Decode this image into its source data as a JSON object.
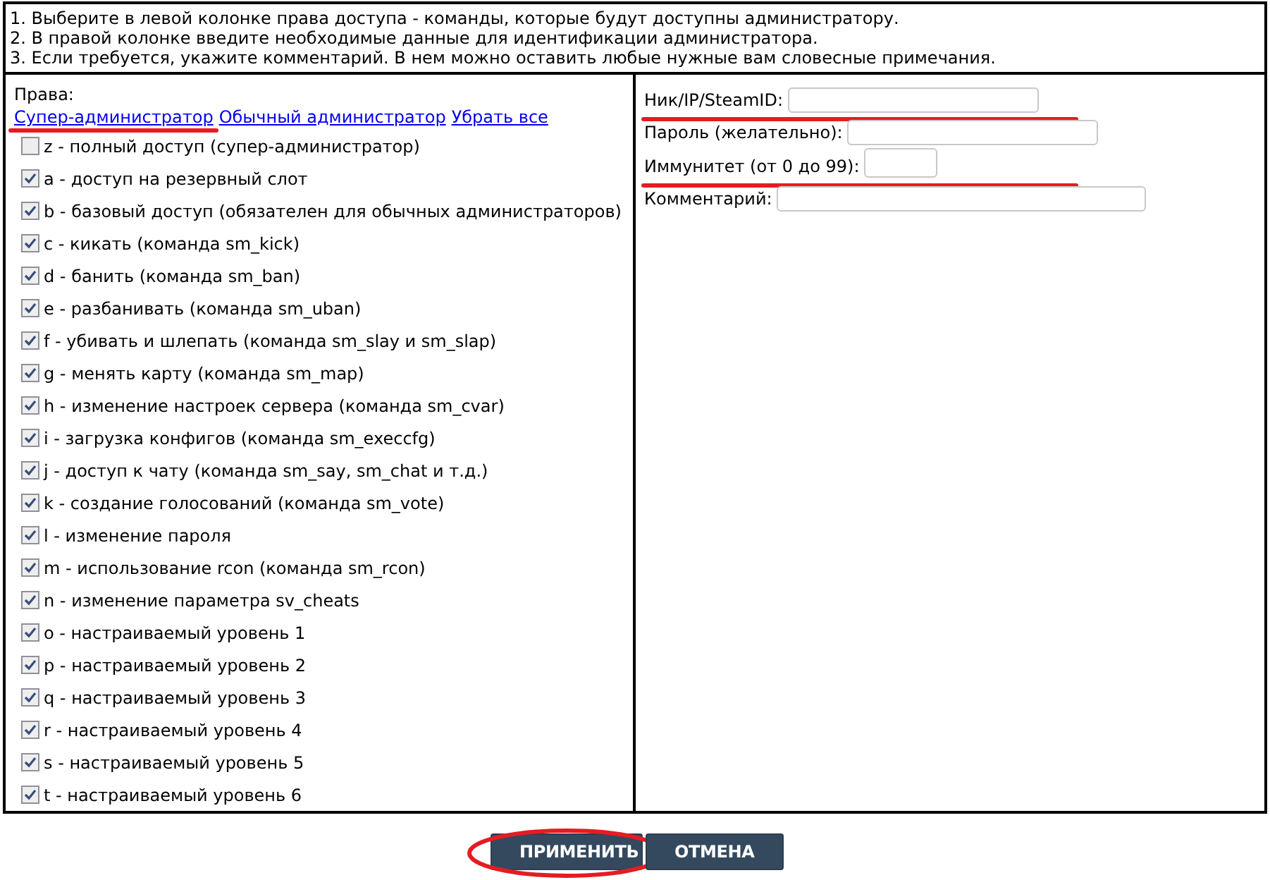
{
  "instructions": [
    "1. Выберите в левой колонке права доступа - команды, которые будут доступны администратору.",
    "2. В правой колонке введите необходимые данные для идентификации администратора.",
    "3. Если требуется, укажите комментарий. В нем можно оставить любые нужные вам словесные примечания."
  ],
  "rights": {
    "label": "Права:",
    "links": [
      {
        "label": "Супер-администратор",
        "marked": true
      },
      {
        "label": "Обычный администратор",
        "marked": false
      },
      {
        "label": "Убрать все",
        "marked": false
      }
    ],
    "flags": [
      {
        "label": "z - полный доступ (супер-администратор)",
        "checked": false
      },
      {
        "label": "a - доступ на резервный слот",
        "checked": true
      },
      {
        "label": "b - базовый доступ (обязателен для обычных администраторов)",
        "checked": true
      },
      {
        "label": "c - кикать (команда sm_kick)",
        "checked": true
      },
      {
        "label": "d - банить (команда sm_ban)",
        "checked": true
      },
      {
        "label": "e - разбанивать (команда sm_uban)",
        "checked": true
      },
      {
        "label": "f - убивать и шлепать (команда sm_slay и sm_slap)",
        "checked": true
      },
      {
        "label": "g - менять карту (команда sm_map)",
        "checked": true
      },
      {
        "label": "h - изменение настроек сервера (команда sm_cvar)",
        "checked": true
      },
      {
        "label": "i - загрузка конфигов (команда sm_execcfg)",
        "checked": true
      },
      {
        "label": "j - доступ к чату (команда sm_say, sm_chat и т.д.)",
        "checked": true
      },
      {
        "label": "k - создание голосований (команда sm_vote)",
        "checked": true
      },
      {
        "label": "l - изменение пароля",
        "checked": true
      },
      {
        "label": "m - использование rcon (команда sm_rcon)",
        "checked": true
      },
      {
        "label": "n - изменение параметра sv_cheats",
        "checked": true
      },
      {
        "label": "o - настраиваемый уровень 1",
        "checked": true
      },
      {
        "label": "p - настраиваемый уровень 2",
        "checked": true
      },
      {
        "label": "q - настраиваемый уровень 3",
        "checked": true
      },
      {
        "label": "r - настраиваемый уровень 4",
        "checked": true
      },
      {
        "label": "s - настраиваемый уровень 5",
        "checked": true
      },
      {
        "label": "t - настраиваемый уровень 6",
        "checked": true
      }
    ]
  },
  "fields": [
    {
      "label": "Ник/IP/SteamID:",
      "kind": "wide",
      "marked": true
    },
    {
      "label": "Пароль (желательно):",
      "kind": "wide",
      "marked": false
    },
    {
      "label": "Иммунитет (от 0 до 99):",
      "kind": "short",
      "marked": true
    },
    {
      "label": "Комментарий:",
      "kind": "long",
      "marked": false
    }
  ],
  "buttons": [
    {
      "label": "ПРИМЕНИТЬ",
      "marked": true
    },
    {
      "label": "ОТМЕНА",
      "marked": false
    }
  ]
}
